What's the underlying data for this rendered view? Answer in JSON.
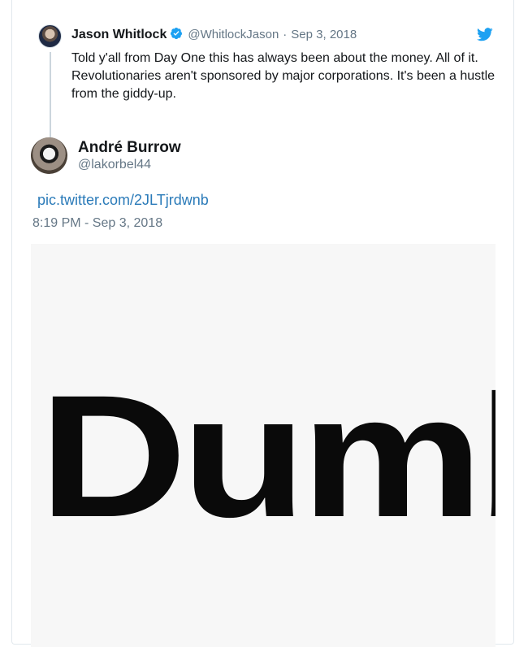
{
  "quoted_tweet": {
    "author_name": "Jason Whitlock",
    "author_handle": "@WhitlockJason",
    "separator": "·",
    "date": "Sep 3, 2018",
    "text": "Told y'all from Day One this has always been about the money. All of it.  Revolutionaries aren't sponsored by major corporations. It's been a hustle from the giddy-up.",
    "verified": true,
    "icons": [
      "verified-badge-icon",
      "twitter-bird-icon"
    ]
  },
  "tweet": {
    "author_name": "André Burrow",
    "author_handle": "@lakorbel44",
    "link_text": "pic.twitter.com/2JLTjrdwnb",
    "timestamp": "8:19 PM - Sep 3, 2018",
    "media_text": "Dumb"
  },
  "colors": {
    "link": "#2b7bb9",
    "muted": "#657786",
    "verified": "#1da1f2",
    "twitter_brand": "#1da1f2"
  }
}
